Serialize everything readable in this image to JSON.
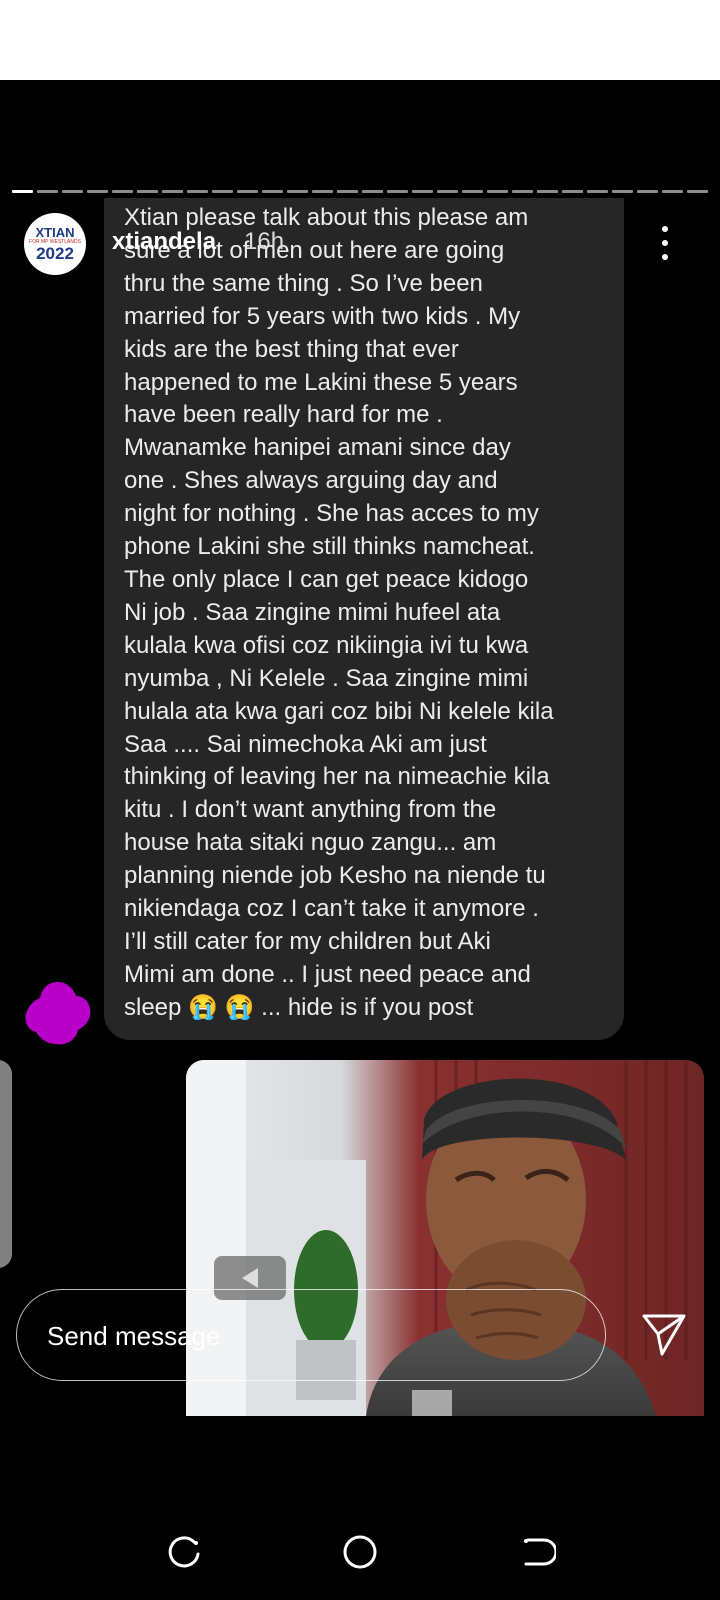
{
  "story": {
    "username": "xtiandela",
    "time_ago": "16h",
    "avatar_text": {
      "line1": "XTIAN",
      "line2": "FOR MP WESTLANDS",
      "line3": "2022"
    },
    "segments_total": 28,
    "active_segment": 1
  },
  "message": {
    "lines": [
      "Xtian please talk about this please am",
      "sure a lot of men out here are going",
      "thru the same thing . So I’ve been",
      "married for 5 years with two kids . My",
      "kids are the best thing that ever",
      "happened to me Lakini these 5 years",
      "have been really hard for me .",
      "Mwanamke hanipei amani since day",
      "one . Shes always arguing day and",
      "night for nothing . She has acces to my",
      "phone Lakini she still thinks namcheat.",
      "The only place I can get peace kidogo",
      "Ni job . Saa zingine mimi hufeel ata",
      "kulala kwa ofisi coz nikiingia ivi tu kwa",
      "nyumba , Ni Kelele . Saa zingine mimi",
      "hulala ata kwa gari coz bibi Ni kelele kila",
      "Saa .... Sai nimechoka Aki am just",
      "thinking of leaving her na nimeachie kila",
      "kitu . I don’t want anything from the",
      "house hata sitaki nguo zangu... am",
      "planning niende job Kesho na niende tu",
      "nikiendaga coz I can’t take it anymore .",
      "I’ll still cater for my children but Aki",
      "Mimi am done .. I just need peace and",
      "sleep 😭 😭 ... hide is if you post"
    ]
  },
  "composer": {
    "placeholder": "Send message"
  },
  "colors": {
    "bubble": "#262626",
    "blob": "#b800c8",
    "background": "#000000"
  },
  "icons": {
    "menu": "kebab-icon",
    "send": "paper-plane-icon",
    "nav_recent": "recents-icon",
    "nav_home": "home-circle-icon",
    "nav_back": "back-icon"
  }
}
